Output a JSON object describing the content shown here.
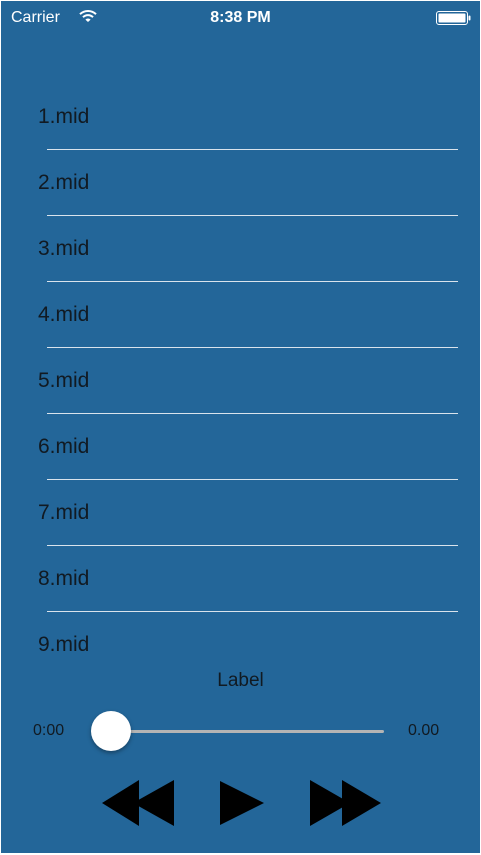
{
  "status_bar": {
    "carrier": "Carrier",
    "time": "8:38 PM",
    "wifi_icon": "wifi-icon",
    "battery_icon": "battery-icon"
  },
  "songs": [
    {
      "label": "1.mid"
    },
    {
      "label": "2.mid"
    },
    {
      "label": "3.mid"
    },
    {
      "label": "4.mid"
    },
    {
      "label": "5.mid"
    },
    {
      "label": "6.mid"
    },
    {
      "label": "7.mid"
    },
    {
      "label": "8.mid"
    },
    {
      "label": "9.mid"
    }
  ],
  "player": {
    "label": "Label",
    "current_time": "0:00",
    "total_time": "0.00",
    "progress": 0.0,
    "controls": {
      "rewind_icon": "rewind-icon",
      "play_icon": "play-icon",
      "forward_icon": "fast-forward-icon"
    }
  },
  "colors": {
    "background": "#236699",
    "separator": "#d9e3ec",
    "text": "#111a22",
    "status_text": "#ffffff",
    "slider_track": "#b4b4b4",
    "slider_thumb": "#ffffff",
    "controls": "#000000"
  }
}
